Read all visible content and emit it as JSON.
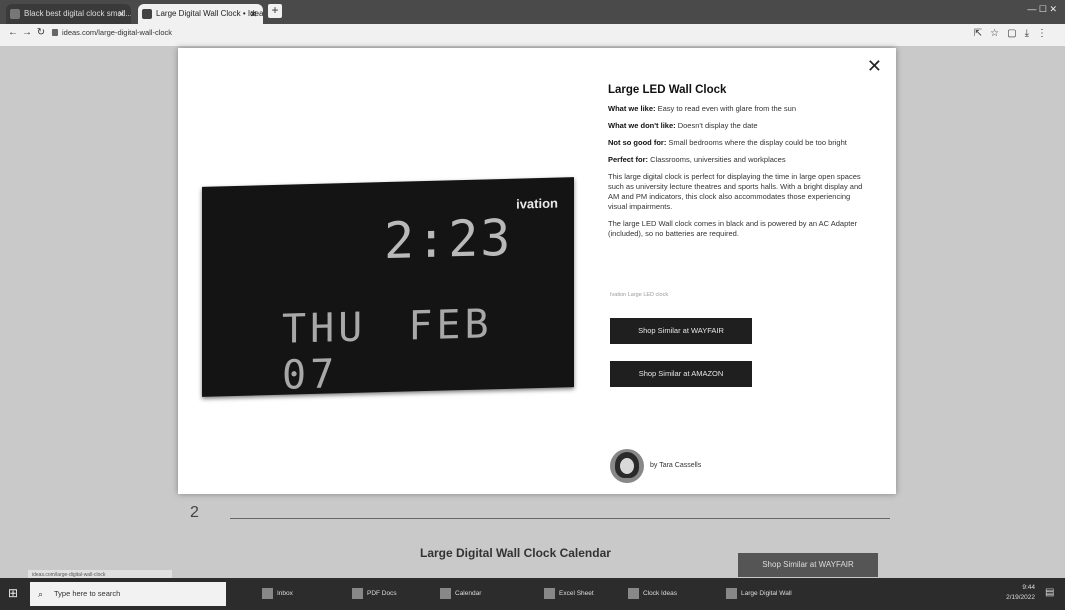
{
  "browser": {
    "tabs": [
      {
        "title": "Black best digital clock small...",
        "active": false
      },
      {
        "title": "Large Digital Wall Clock • Ideas",
        "active": true
      }
    ],
    "url": "ideas.com/large-digital-wall-clock",
    "new_tab_label": "+"
  },
  "modal": {
    "close_label": "✕",
    "title": "Large LED Wall Clock",
    "like_label": "What we like:",
    "like_text": "Easy to read even with glare from the sun",
    "dislike_label": "What we don't like:",
    "dislike_text": "Doesn't display the date",
    "notgood_label": "Not so good for:",
    "notgood_text": "Small bedrooms where the display could be too bright",
    "perfect_label": "Perfect for:",
    "perfect_text": "Classrooms, universities and workplaces",
    "desc1": "This large digital clock is perfect for displaying the time in large open spaces such as university lecture theatres and sports halls. With a bright display and AM and PM indicators, this clock also accommodates those experiencing visual impairments.",
    "desc2": "The large LED Wall clock comes in black and is powered by an AC Adapter (included), so no batteries are required.",
    "caption": "Ivation Large LED clock",
    "btn_wayfair": "Shop Similar at WAYFAIR",
    "btn_amazon": "Shop Similar at AMAZON",
    "author": "by Tara Cassells",
    "clock": {
      "brand": "ivation",
      "time": "2:23",
      "date": "THU FEB 07"
    }
  },
  "background": {
    "item_number": "2",
    "item_title": "Large Digital Wall Clock Calendar",
    "item_button": "Shop Similar at WAYFAIR"
  },
  "taskbar": {
    "search_placeholder": "Type here to search",
    "items": [
      "Inbox",
      "PDF Docs",
      "Calendar",
      "Excel Sheet",
      "Clock Ideas",
      "Large Digital Wall"
    ],
    "time": "9:44",
    "date": "2/19/2022"
  },
  "status_url": "ideas.com/large-digital-wall-clock"
}
